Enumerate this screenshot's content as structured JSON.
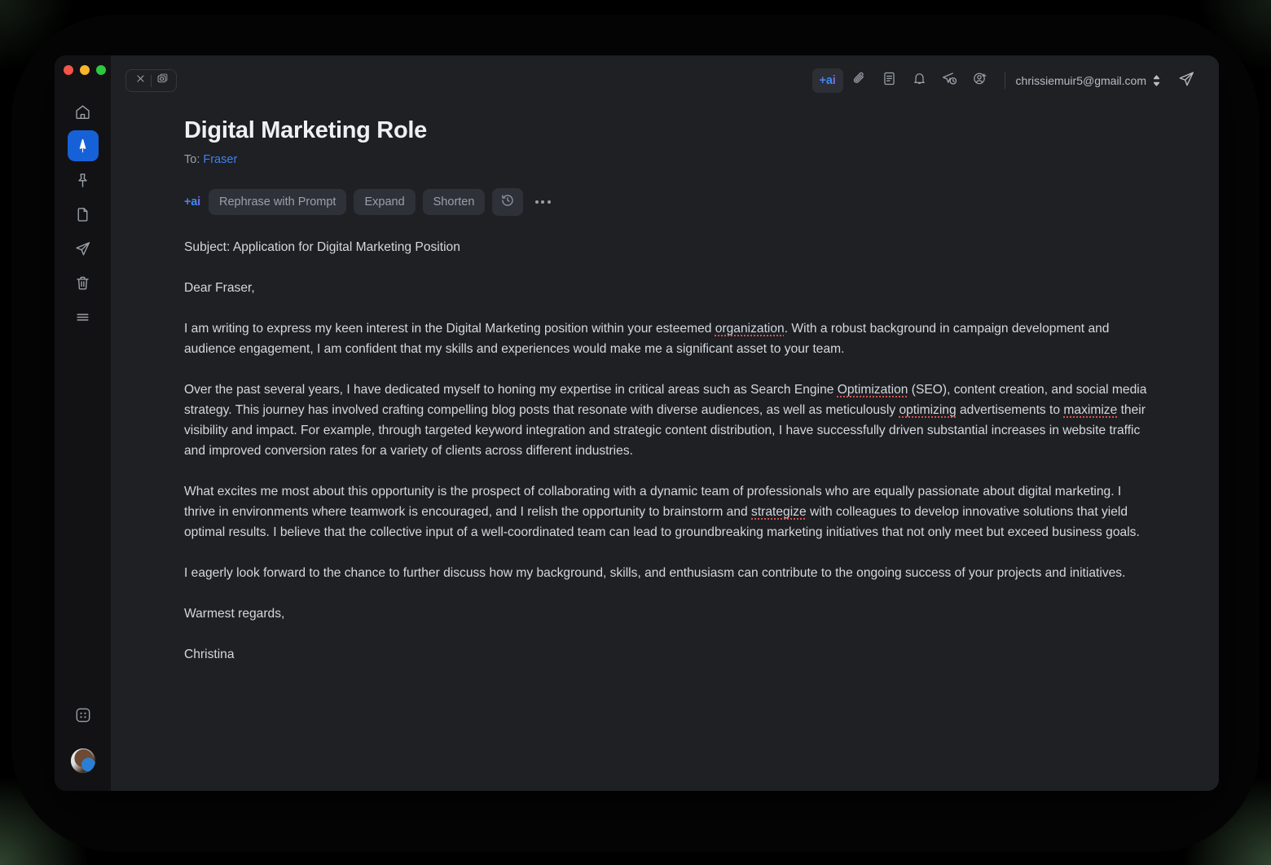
{
  "window": {
    "traffic_lights": [
      {
        "name": "close",
        "color": "#f3544a"
      },
      {
        "name": "minimize",
        "color": "#fcb42b"
      },
      {
        "name": "zoom",
        "color": "#2cc93f"
      }
    ]
  },
  "sidebar": {
    "items": [
      {
        "name": "home",
        "icon": "home-icon",
        "active": false
      },
      {
        "name": "compose",
        "icon": "paper-plane-filled-icon",
        "active": true
      },
      {
        "name": "pinned",
        "icon": "pin-icon",
        "active": false
      },
      {
        "name": "drafts",
        "icon": "file-icon",
        "active": false
      },
      {
        "name": "sent",
        "icon": "send-icon",
        "active": false
      },
      {
        "name": "trash",
        "icon": "trash-icon",
        "active": false
      },
      {
        "name": "menu",
        "icon": "hamburger-icon",
        "active": false
      }
    ],
    "bottom": [
      {
        "name": "apps",
        "icon": "grid-apps-icon"
      },
      {
        "name": "account-avatar",
        "icon": "avatar"
      }
    ]
  },
  "topbar": {
    "window_controls": [
      {
        "name": "close-compose",
        "icon": "close-icon"
      },
      {
        "name": "pop-out-compose",
        "icon": "window-restore-icon"
      }
    ],
    "tools": [
      {
        "name": "ai",
        "icon": "ai-badge",
        "label": "+ai"
      },
      {
        "name": "attach",
        "icon": "paperclip-icon"
      },
      {
        "name": "template",
        "icon": "document-icon"
      },
      {
        "name": "reminder",
        "icon": "bell-icon"
      },
      {
        "name": "send-later",
        "icon": "send-clock-icon"
      },
      {
        "name": "add-recipient",
        "icon": "person-add-icon"
      }
    ],
    "account": {
      "email": "chrissiemuir5@gmail.com",
      "chevron_icon": "chevron-updown-icon"
    },
    "send": {
      "name": "send",
      "icon": "send-icon"
    }
  },
  "compose": {
    "title": "Digital Marketing Role",
    "to_label": "To:",
    "to_recipient": "Fraser",
    "ai_toolbar": {
      "badge": "+ai",
      "badge_parts": {
        "plus": "+",
        "a": "a",
        "i": "i"
      },
      "buttons": [
        {
          "name": "rephrase-with-prompt",
          "label": "Rephrase with Prompt"
        },
        {
          "name": "expand",
          "label": "Expand"
        },
        {
          "name": "shorten",
          "label": "Shorten"
        }
      ],
      "history_icon": "clock-history-icon",
      "more_icon": "more-horizontal-icon"
    },
    "body": {
      "subject_line": "Subject: Application for Digital Marketing Position",
      "greeting": "Dear Fraser,",
      "p1_a": "I am writing to express my keen interest in the Digital Marketing position within your esteemed ",
      "p1_sp1": "organization",
      "p1_b": ". With a robust background in campaign development and audience engagement, I am confident that my skills and experiences would make me a significant asset to your team.",
      "p2_a": "Over the past several years, I have dedicated myself to honing my expertise in critical areas such as Search Engine ",
      "p2_sp1": "Optimization",
      "p2_b": " (SEO), content creation, and social media strategy. This journey has involved crafting compelling blog posts that resonate with diverse audiences, as well as meticulously ",
      "p2_sp2": "optimizing",
      "p2_c": " advertisements to ",
      "p2_sp3": "maximize",
      "p2_d": " their visibility and impact. For example, through targeted keyword integration and strategic content distribution, I have successfully driven substantial increases in website traffic and improved conversion rates for a variety of clients across different industries.",
      "p3_a": "What excites me most about this opportunity is the prospect of collaborating with a dynamic team of professionals who are equally passionate about digital marketing. I thrive in environments where teamwork is encouraged, and I relish the opportunity to brainstorm and ",
      "p3_sp1": "strategize",
      "p3_b": " with colleagues to develop innovative solutions that yield optimal results. I believe that the collective input of a well-coordinated team can lead to groundbreaking marketing initiatives that not only meet but exceed business goals.",
      "p4": "I eagerly look forward to the chance to further discuss how my background, skills, and enthusiasm can contribute to the ongoing success of your projects and initiatives.",
      "signoff": "Warmest regards,",
      "signature": "Christina"
    }
  },
  "colors": {
    "window_bg": "#1e2024",
    "rail_bg": "#121214",
    "accent_blue": "#1761d8",
    "link_blue": "#3b82f0",
    "chip_bg": "#2e3138",
    "text_primary": "#d4d8dd",
    "text_muted": "#9aa0a8",
    "spellcheck_red": "#d9534f"
  }
}
